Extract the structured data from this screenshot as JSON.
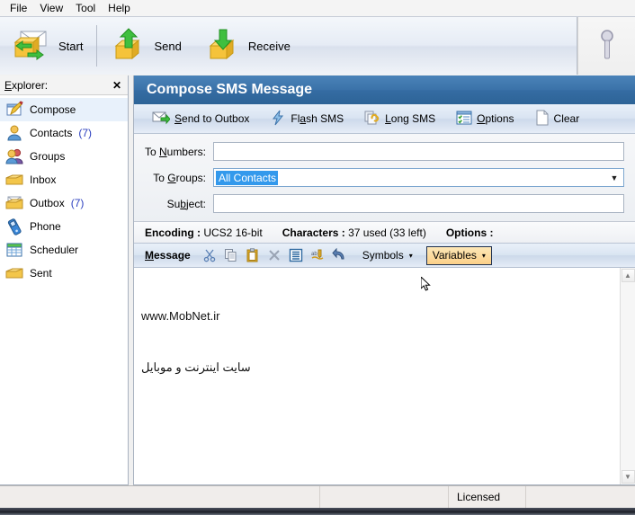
{
  "menubar": {
    "items": [
      {
        "label": "File"
      },
      {
        "label": "View"
      },
      {
        "label": "Tool"
      },
      {
        "label": "Help"
      }
    ]
  },
  "toolbar": {
    "buttons": [
      {
        "label": "Start",
        "icon": "start-envelope-arrows-icon"
      },
      {
        "label": "Send",
        "icon": "send-outbox-up-arrow-icon"
      },
      {
        "label": "Receive",
        "icon": "receive-inbox-down-arrow-icon"
      }
    ],
    "right_icon": "key-disabled-icon"
  },
  "sidebar": {
    "title": "Explorer:",
    "close_label": "✕",
    "items": [
      {
        "label": "Compose",
        "count": "",
        "icon": "compose-pencil-icon",
        "selected": true
      },
      {
        "label": "Contacts",
        "count": "(7)",
        "icon": "contact-person-icon",
        "selected": false
      },
      {
        "label": "Groups",
        "count": "",
        "icon": "groups-people-icon",
        "selected": false
      },
      {
        "label": "Inbox",
        "count": "",
        "icon": "inbox-folder-icon",
        "selected": false
      },
      {
        "label": "Outbox",
        "count": "(7)",
        "icon": "outbox-envelope-icon",
        "selected": false
      },
      {
        "label": "Phone",
        "count": "",
        "icon": "phone-mobile-icon",
        "selected": false
      },
      {
        "label": "Scheduler",
        "count": "",
        "icon": "scheduler-calendar-icon",
        "selected": false
      },
      {
        "label": "Sent",
        "count": "",
        "icon": "sent-folder-icon",
        "selected": false
      }
    ]
  },
  "main": {
    "title": "Compose SMS Message",
    "commands": [
      {
        "label": "Send to Outbox",
        "accesskey": "S",
        "icon": "send-envelope-icon"
      },
      {
        "label": "Flash SMS",
        "accesskey": "a",
        "icon": "flash-lightning-icon"
      },
      {
        "label": "Long SMS",
        "accesskey": "L",
        "icon": "long-sms-chain-icon"
      },
      {
        "label": "Options",
        "accesskey": "O",
        "icon": "options-checklist-icon"
      },
      {
        "label": "Clear",
        "accesskey": "",
        "icon": "clear-page-icon"
      }
    ],
    "form": {
      "to_numbers": {
        "label_pre": "To ",
        "label_key": "N",
        "label_post": "umbers:",
        "value": "",
        "placeholder": ""
      },
      "to_groups": {
        "label_pre": "To ",
        "label_key": "G",
        "label_post": "roups:",
        "value": "All Contacts",
        "arrow": "▼"
      },
      "subject": {
        "label_pre": "Su",
        "label_key": "b",
        "label_post": "ject:",
        "value": "",
        "placeholder": ""
      }
    },
    "encoding_bar": {
      "encoding_label": "Encoding :",
      "encoding_value": "UCS2 16-bit",
      "characters_label": "Characters :",
      "characters_value": "37 used (33 left)",
      "options_label": "Options :",
      "options_value": ""
    },
    "message_bar": {
      "label": "Message",
      "label_key": "M",
      "icons": [
        {
          "name": "cut-scissors-icon"
        },
        {
          "name": "copy-pages-icon"
        },
        {
          "name": "paste-clipboard-icon"
        },
        {
          "name": "delete-x-icon"
        },
        {
          "name": "select-all-lines-icon"
        },
        {
          "name": "spellcheck-abc-icon"
        },
        {
          "name": "undo-arrow-icon"
        }
      ],
      "symbols_button": {
        "label": "Symbols",
        "caret": "▾",
        "hovered": false
      },
      "variables_button": {
        "label": "Variables",
        "caret": "▾",
        "hovered": true
      }
    },
    "editor": {
      "line1": "www.MobNet.ir",
      "line2": "سایت اینترنت و موبایل"
    },
    "scrollbar": {
      "up": "▲",
      "down": "▼"
    }
  },
  "statusbar": {
    "cells": [
      "",
      "",
      "Licensed",
      ""
    ]
  },
  "colors": {
    "title_blue": "#3b72a9",
    "accent_blue": "#2b3fbf",
    "selection_blue": "#3399ec",
    "hover_orange": "#fbd089"
  }
}
